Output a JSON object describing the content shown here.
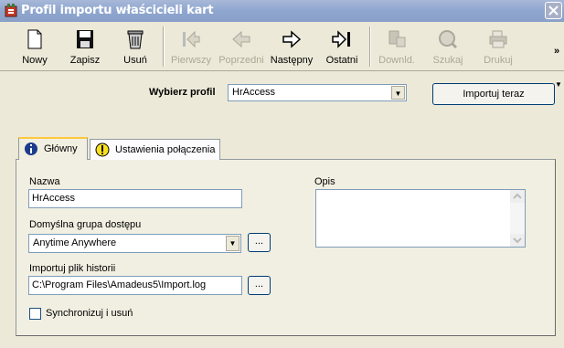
{
  "window": {
    "title": "Profil importu właścicieli kart"
  },
  "toolbar": {
    "buttons": [
      {
        "label": "Nowy",
        "icon": "new-document-icon",
        "enabled": true
      },
      {
        "label": "Zapisz",
        "icon": "floppy-disk-icon",
        "enabled": true
      },
      {
        "label": "Usuń",
        "icon": "trash-bin-icon",
        "enabled": true
      },
      {
        "label": "Pierwszy",
        "icon": "arrow-first-icon",
        "enabled": false
      },
      {
        "label": "Poprzedni",
        "icon": "arrow-left-icon",
        "enabled": false
      },
      {
        "label": "Następny",
        "icon": "arrow-right-icon",
        "enabled": true
      },
      {
        "label": "Ostatni",
        "icon": "arrow-last-icon",
        "enabled": true
      },
      {
        "label": "Downld.",
        "icon": "download-icon",
        "enabled": false
      },
      {
        "label": "Szukaj",
        "icon": "search-icon",
        "enabled": false
      },
      {
        "label": "Drukuj",
        "icon": "printer-icon",
        "enabled": false
      }
    ],
    "overflow_label": "»"
  },
  "profile": {
    "label": "Wybierz profil",
    "selected": "HrAccess"
  },
  "import_button": "Importuj teraz",
  "tabs": [
    {
      "label": "Główny",
      "icon": "info-icon",
      "active": true
    },
    {
      "label": "Ustawienia połączenia",
      "icon": "warning-icon",
      "active": false
    }
  ],
  "form": {
    "name_label": "Nazwa",
    "name_value": "HrAccess",
    "group_label": "Domyślna grupa dostępu",
    "group_value": "Anytime Anywhere",
    "history_label": "Importuj plik historii",
    "history_value": "C:\\Program Files\\Amadeus5\\Import.log",
    "description_label": "Opis",
    "description_value": "",
    "browse_label": "...",
    "sync_label": "Synchronizuj i usuń",
    "sync_checked": false
  },
  "colors": {
    "title_gradient": "#8ea6cf",
    "face": "#ece9d8",
    "close_button": "#d8543a"
  }
}
